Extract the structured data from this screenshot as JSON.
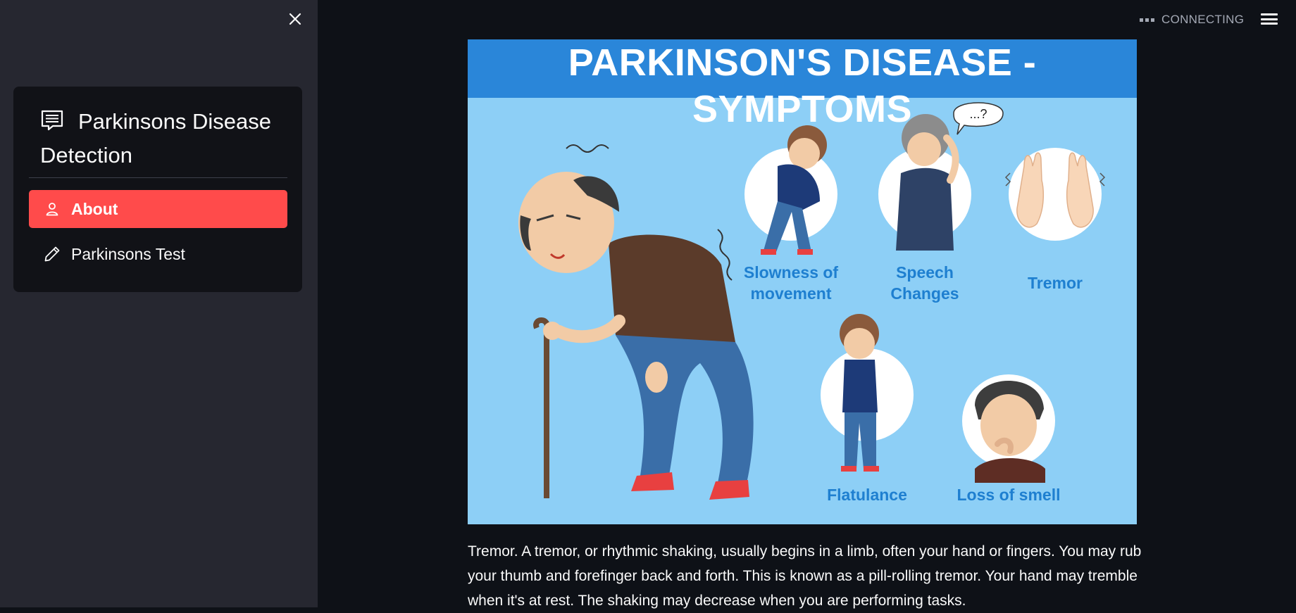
{
  "sidebar": {
    "close_icon": "close-icon",
    "title": "Parkinsons Disease Detection",
    "title_icon": "list-alt-icon",
    "items": [
      {
        "label": "About",
        "icon": "person-icon",
        "active": true
      },
      {
        "label": "Parkinsons Test",
        "icon": "pencil-icon",
        "active": false
      }
    ],
    "active_color": "#ff4b4b"
  },
  "header": {
    "status": "CONNECTING",
    "menu_icon": "hamburger-menu-icon"
  },
  "infographic": {
    "title": "PARKINSON'S DISEASE - SYMPTOMS",
    "speech_bubble": "...?",
    "symptoms": [
      {
        "line1": "Slowness of",
        "line2": "movement"
      },
      {
        "line1": "Speech",
        "line2": "Changes"
      },
      {
        "line1": "Tremor",
        "line2": ""
      },
      {
        "line1": "Flatulance",
        "line2": ""
      },
      {
        "line1": "Loss of smell",
        "line2": ""
      }
    ]
  },
  "main": {
    "description": "Tremor. A tremor, or rhythmic shaking, usually begins in a limb, often your hand or fingers. You may rub your thumb and forefinger back and forth. This is known as a pill-rolling tremor. Your hand may tremble when it's at rest. The shaking may decrease when you are performing tasks."
  }
}
